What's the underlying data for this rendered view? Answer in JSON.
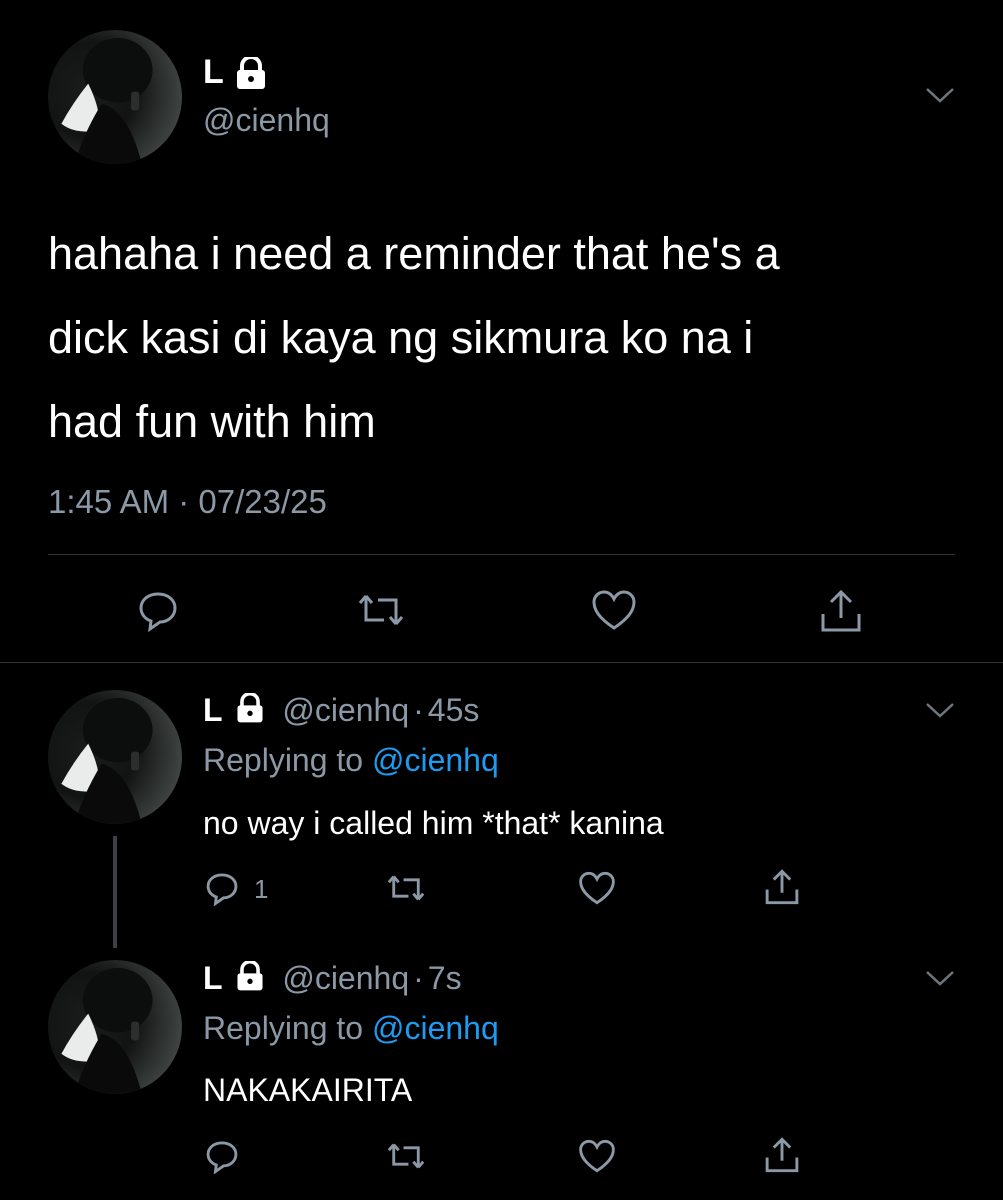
{
  "main_tweet": {
    "name": "L",
    "handle": "@cienhq",
    "text_lines": [
      "hahaha i need a reminder that he's a",
      "dick kasi di kaya ng sikmura ko na i",
      "had fun with him"
    ],
    "timestamp": "1:45 AM · 07/23/25"
  },
  "replies": [
    {
      "name": "L",
      "handle": "@cienhq",
      "sep": "·",
      "age": "45s",
      "replying_label": "Replying to",
      "replying_handle": "@cienhq",
      "text": "no way i called him *that* kanina",
      "reply_count": "1"
    },
    {
      "name": "L",
      "handle": "@cienhq",
      "sep": "·",
      "age": "7s",
      "replying_label": "Replying to",
      "replying_handle": "@cienhq",
      "text": "NAKAKAIRITA",
      "reply_count": ""
    }
  ],
  "icons": {
    "reply": "reply-icon",
    "retweet": "retweet-icon",
    "like": "like-icon",
    "share": "share-icon",
    "lock": "lock-icon",
    "menu": "chevron-down-icon"
  },
  "colors": {
    "background": "#000000",
    "text": "#ffffff",
    "muted": "#8b98a5",
    "link": "#1d9bf0",
    "divider": "#2f3336"
  }
}
